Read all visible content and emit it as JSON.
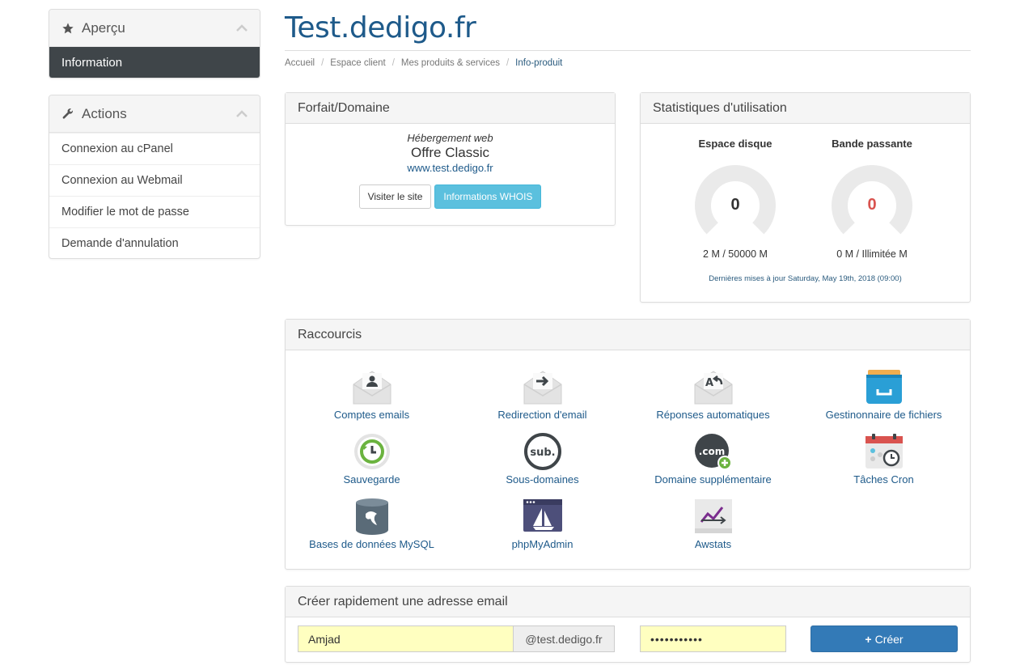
{
  "sidebar": {
    "overview": {
      "title": "Aperçu",
      "icon": "star-icon",
      "active_item": "Information"
    },
    "actions": {
      "title": "Actions",
      "icon": "wrench-icon",
      "items": [
        {
          "label": "Connexion au cPanel"
        },
        {
          "label": "Connexion au Webmail"
        },
        {
          "label": "Modifier le mot de passe"
        },
        {
          "label": "Demande d'annulation"
        }
      ]
    }
  },
  "page": {
    "title": "Test.dedigo.fr",
    "breadcrumb": [
      "Accueil",
      "Espace client",
      "Mes produits & services",
      "Info-produit"
    ]
  },
  "forfait": {
    "title": "Forfait/Domaine",
    "type": "Hébergement web",
    "offer": "Offre Classic",
    "url": "www.test.dedigo.fr",
    "visit_button": "Visiter le site",
    "whois_button": "Informations WHOIS"
  },
  "stats": {
    "title": "Statistiques d'utilisation",
    "disk": {
      "label": "Espace disque",
      "value": "0",
      "usage": "2 M / 50000 M",
      "value_color": "#333333"
    },
    "bandwidth": {
      "label": "Bande passante",
      "value": "0",
      "usage": "0 M / Illimitée M",
      "value_color": "#d9534f"
    },
    "updated": "Dernières mises à jour Saturday, May 19th, 2018 (09:00)"
  },
  "shortcuts": {
    "title": "Raccourcis",
    "items": [
      {
        "label": "Comptes emails",
        "icon": "email-account-icon"
      },
      {
        "label": "Redirection d'email",
        "icon": "email-forward-icon"
      },
      {
        "label": "Réponses automatiques",
        "icon": "autoresponder-icon"
      },
      {
        "label": "Gestinonnaire de fichiers",
        "icon": "file-manager-icon"
      },
      {
        "label": "Sauvegarde",
        "icon": "backup-icon"
      },
      {
        "label": "Sous-domaines",
        "icon": "subdomain-icon"
      },
      {
        "label": "Domaine supplémentaire",
        "icon": "addon-domain-icon"
      },
      {
        "label": "Tâches Cron",
        "icon": "cron-icon"
      },
      {
        "label": "Bases de données MySQL",
        "icon": "mysql-icon"
      },
      {
        "label": "phpMyAdmin",
        "icon": "phpmyadmin-icon"
      },
      {
        "label": "Awstats",
        "icon": "awstats-icon"
      }
    ]
  },
  "email_create": {
    "title": "Créer rapidement une adresse email",
    "username": "Amjad",
    "domain": "@test.dedigo.fr",
    "password": "•••••••••••",
    "button": "Créer"
  },
  "colors": {
    "accent": "#1e5a8a",
    "primary_button": "#337ab7",
    "info_button": "#5bc0de",
    "input_highlight": "#ffffc0",
    "sidebar_active": "#3f4549"
  }
}
